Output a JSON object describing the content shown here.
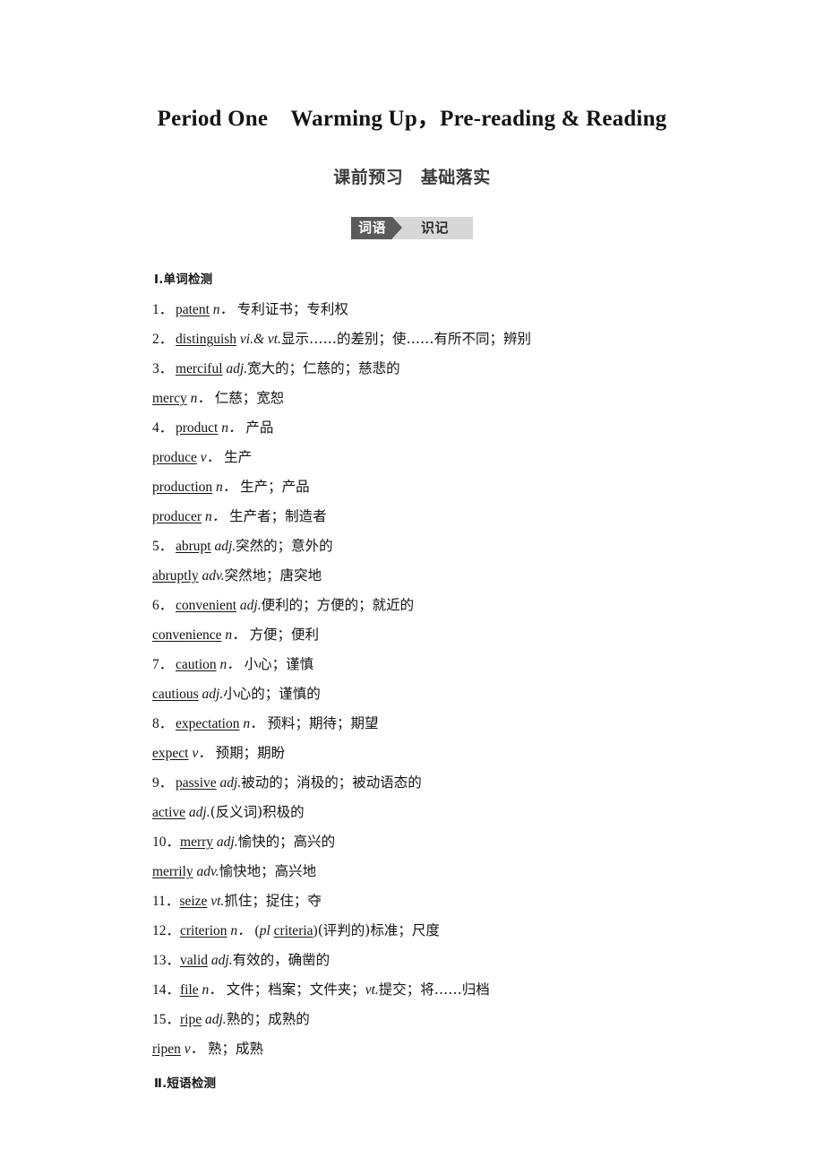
{
  "title": "Period One　Warming Up，Pre-reading & Reading",
  "section_heading": "课前预习　基础落实",
  "badge": {
    "left_label": "词语",
    "right_label": "识记",
    "arrow_icon": "triangle-right-icon",
    "dark_color": "#5b5b5b",
    "light_color": "#d7d7d7"
  },
  "part_one_heading": "Ⅰ.单词检测",
  "part_two_heading": "Ⅱ.短语检测",
  "entries": [
    {
      "num": "1．",
      "word": "patent",
      "pos": "n．",
      "gap": " ",
      "def": "专利证书；专利权"
    },
    {
      "num": "2．",
      "word": "distinguish",
      "pos": "vi.& vt.",
      "gap": "",
      "def": "显示……的差别；使……有所不同；辨别"
    },
    {
      "num": "3．",
      "word": "merciful",
      "pos": "adj.",
      "gap": "",
      "def": "宽大的；仁慈的；慈悲的"
    },
    {
      "num": "",
      "word": "mercy",
      "pos": "n．",
      "gap": " ",
      "def": "仁慈；宽恕"
    },
    {
      "num": "4．",
      "word": "product",
      "pos": "n．",
      "gap": " ",
      "def": "产品"
    },
    {
      "num": "",
      "word": "produce",
      "pos": "v．",
      "gap": " ",
      "def": "生产"
    },
    {
      "num": "",
      "word": "production",
      "pos": "n．",
      "gap": " ",
      "def": "生产；产品"
    },
    {
      "num": "",
      "word": "producer",
      "pos": "n．",
      "gap": " ",
      "def": "生产者；制造者"
    },
    {
      "num": "5．",
      "word": "abrupt",
      "pos": "adj.",
      "gap": "",
      "def": "突然的；意外的"
    },
    {
      "num": "",
      "word": "abruptly",
      "pos": "adv.",
      "gap": "",
      "def": "突然地；唐突地"
    },
    {
      "num": "6．",
      "word": "convenient",
      "pos": "adj.",
      "gap": "",
      "def": "便利的；方便的；就近的"
    },
    {
      "num": "",
      "word": "convenience",
      "pos": "n．",
      "gap": " ",
      "def": "方便；便利"
    },
    {
      "num": "7．",
      "word": "caution",
      "pos": "n．",
      "gap": " ",
      "def": "小心；谨慎"
    },
    {
      "num": "",
      "word": "cautious",
      "pos": "adj.",
      "gap": "",
      "def": "小心的；谨慎的"
    },
    {
      "num": "8．",
      "word": "expectation",
      "pos": "n．",
      "gap": " ",
      "def": "预料；期待；期望"
    },
    {
      "num": "",
      "word": "expect",
      "pos": "v．",
      "gap": " ",
      "def": "预期；期盼"
    },
    {
      "num": "9．",
      "word": "passive",
      "pos": "adj.",
      "gap": "",
      "def": "被动的；消极的；被动语态的"
    },
    {
      "num": "",
      "word": "active",
      "pos": "adj.",
      "gap": "",
      "def": "(反义词)积极的"
    },
    {
      "num": "10．",
      "word": "merry",
      "pos": "adj.",
      "gap": "",
      "def": "愉快的；高兴的"
    },
    {
      "num": "",
      "word": "merrily",
      "pos": "adv.",
      "gap": "",
      "def": "愉快地；高兴地"
    },
    {
      "num": "11．",
      "word": "seize",
      "pos": "vt.",
      "gap": "",
      "def": "抓住；捉住；夺"
    },
    {
      "num": "12．",
      "word": "criterion",
      "pos": "n．",
      "gap": " ",
      "def": "",
      "extra_plural": {
        "open": "(",
        "pos": "pl",
        "space": " ",
        "word": "criteria",
        "close": ")"
      },
      "def_after": "(评判的)标准；尺度"
    },
    {
      "num": "13．",
      "word": "valid",
      "pos": "adj.",
      "gap": "",
      "def": "有效的，确凿的"
    },
    {
      "num": "14．",
      "word": "file",
      "pos": "n．",
      "gap": " ",
      "def": "文件；档案；文件夹；",
      "pos2": "vt.",
      "def2": "提交；将……归档"
    },
    {
      "num": "15．",
      "word": "ripe",
      "pos": "adj.",
      "gap": "",
      "def": "熟的；成熟的"
    },
    {
      "num": "",
      "word": "ripen",
      "pos": "v．",
      "gap": " ",
      "def": "熟；成熟"
    }
  ]
}
